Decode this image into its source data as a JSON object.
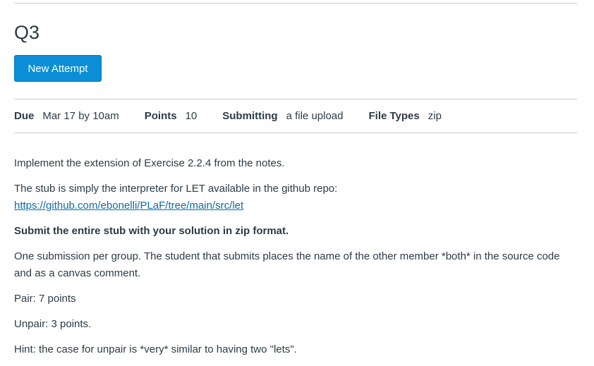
{
  "assignment": {
    "title": "Q3",
    "new_attempt_label": "New Attempt"
  },
  "details": {
    "due_label": "Due",
    "due_value": "Mar 17 by 10am",
    "points_label": "Points",
    "points_value": "10",
    "submitting_label": "Submitting",
    "submitting_value": "a file upload",
    "file_types_label": "File Types",
    "file_types_value": "zip"
  },
  "description": {
    "p1": "Implement the extension of Exercise 2.2.4 from the notes.",
    "p2_text": "The stub is simply the interpreter for LET available in the github repo:",
    "p2_link": "https://github.com/ebonelli/PLaF/tree/main/src/let",
    "p3": "Submit the entire stub with your solution in zip format.",
    "p4": "One submission per group. The student that submits places the name of the other member *both* in the source code and as a canvas comment.",
    "p5": "Pair: 7 points",
    "p6": "Unpair: 3 points.",
    "p7": "Hint: the case for unpair is *very* similar to having two \"lets\"."
  },
  "colors": {
    "button_bg": "#0b8ed6",
    "text": "#2d3b45",
    "link": "#0b6ba8",
    "rule": "#c7cdd1"
  }
}
